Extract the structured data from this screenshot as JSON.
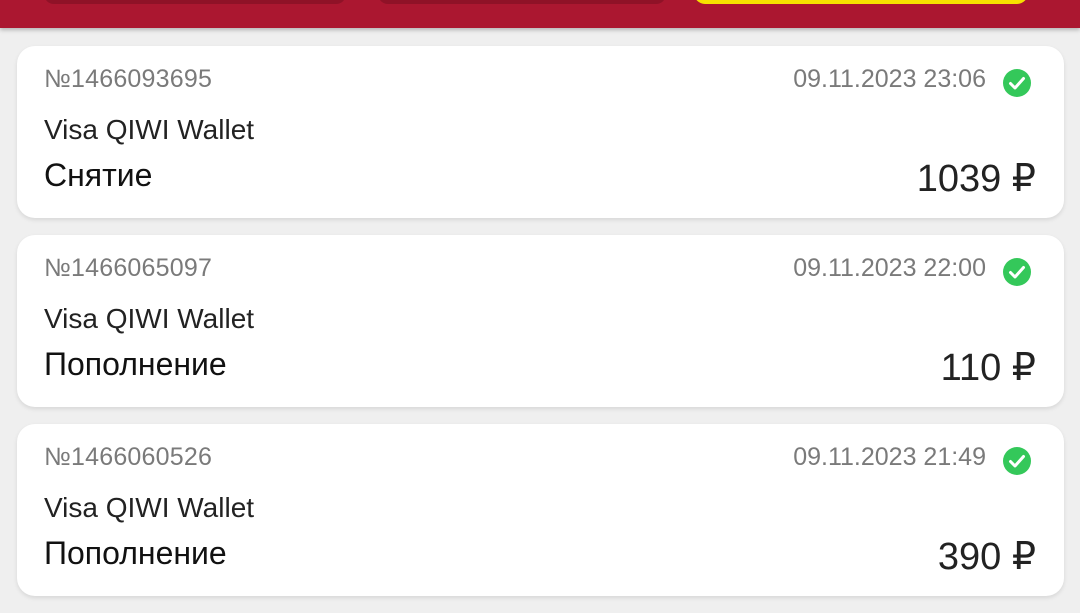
{
  "colors": {
    "header": "#ab1730",
    "accent_button": "#f7e100",
    "status_success": "#34c85a",
    "background": "#efefef"
  },
  "transactions": [
    {
      "number": "№1466093695",
      "date": "09.11.2023 23:06",
      "provider": "Visa QIWI Wallet",
      "type": "Снятие",
      "amount": "1039 ₽",
      "status_icon": "check-circle-icon"
    },
    {
      "number": "№1466065097",
      "date": "09.11.2023 22:00",
      "provider": "Visa QIWI Wallet",
      "type": "Пополнение",
      "amount": "110 ₽",
      "status_icon": "check-circle-icon"
    },
    {
      "number": "№1466060526",
      "date": "09.11.2023 21:49",
      "provider": "Visa QIWI Wallet",
      "type": "Пополнение",
      "amount": "390 ₽",
      "status_icon": "check-circle-icon"
    }
  ]
}
